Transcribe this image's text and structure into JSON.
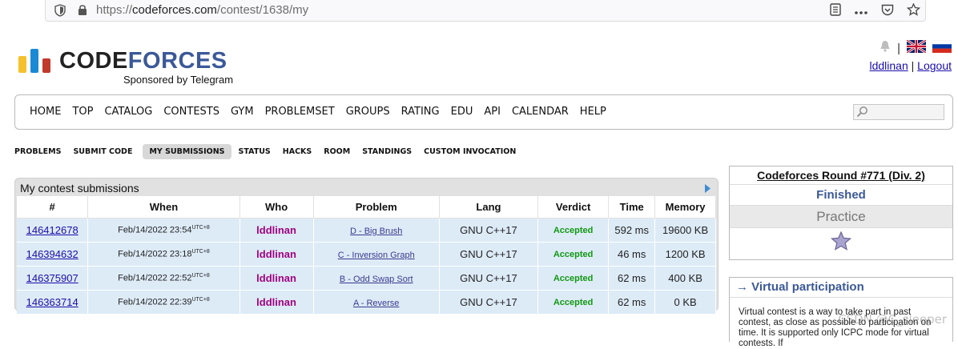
{
  "browser": {
    "url_prefix": "https://",
    "url_domain": "codeforces.com",
    "url_path": "/contest/1638/my"
  },
  "header": {
    "logo_text_code": "CODE",
    "logo_text_forces": "FORCES",
    "logo_sub": "Sponsored by Telegram",
    "separator": "|",
    "username": "lddlinan",
    "logout": "Logout"
  },
  "main_nav": [
    "HOME",
    "TOP",
    "CATALOG",
    "CONTESTS",
    "GYM",
    "PROBLEMSET",
    "GROUPS",
    "RATING",
    "EDU",
    "API",
    "CALENDAR",
    "HELP"
  ],
  "sub_nav": [
    {
      "label": "PROBLEMS",
      "active": false
    },
    {
      "label": "SUBMIT CODE",
      "active": false
    },
    {
      "label": "MY SUBMISSIONS",
      "active": true
    },
    {
      "label": "STATUS",
      "active": false
    },
    {
      "label": "HACKS",
      "active": false
    },
    {
      "label": "ROOM",
      "active": false
    },
    {
      "label": "STANDINGS",
      "active": false
    },
    {
      "label": "CUSTOM INVOCATION",
      "active": false
    }
  ],
  "submissions": {
    "title": "My contest submissions",
    "columns": [
      "#",
      "When",
      "Who",
      "Problem",
      "Lang",
      "Verdict",
      "Time",
      "Memory"
    ],
    "rows": [
      {
        "id": "146412678",
        "when": "Feb/14/2022 23:54",
        "tz": "UTC+8",
        "who": "lddlinan",
        "problem": "D - Big Brush",
        "lang": "GNU C++17",
        "verdict": "Accepted",
        "time": "592 ms",
        "memory": "19600 KB"
      },
      {
        "id": "146394632",
        "when": "Feb/14/2022 23:18",
        "tz": "UTC+8",
        "who": "lddlinan",
        "problem": "C - Inversion Graph",
        "lang": "GNU C++17",
        "verdict": "Accepted",
        "time": "46 ms",
        "memory": "1200 KB"
      },
      {
        "id": "146375907",
        "when": "Feb/14/2022 22:52",
        "tz": "UTC+8",
        "who": "lddlinan",
        "problem": "B - Odd Swap Sort",
        "lang": "GNU C++17",
        "verdict": "Accepted",
        "time": "62 ms",
        "memory": "400 KB"
      },
      {
        "id": "146363714",
        "when": "Feb/14/2022 22:39",
        "tz": "UTC+8",
        "who": "lddlinan",
        "problem": "A - Reverse",
        "lang": "GNU C++17",
        "verdict": "Accepted",
        "time": "62 ms",
        "memory": "0 KB"
      }
    ]
  },
  "sidebar": {
    "round_title": "Codeforces Round #771 (Div. 2)",
    "status": "Finished",
    "phase": "Practice",
    "virtual_title": "→ Virtual participation",
    "virtual_text": "Virtual contest is a way to take part in past contest, as close as possible to participation on time. It is supported only ICPC mode for virtual contests. If"
  },
  "watermark": "CSDN @C_sleeper",
  "colors": {
    "brand_blue": "#3b5998",
    "logo_yellow": "#f6c02c",
    "logo_blue": "#1a8ad4",
    "logo_red": "#c0392b",
    "row_bg": "#ddebf7",
    "accepted": "#119911",
    "user_color": "#a0007f"
  }
}
